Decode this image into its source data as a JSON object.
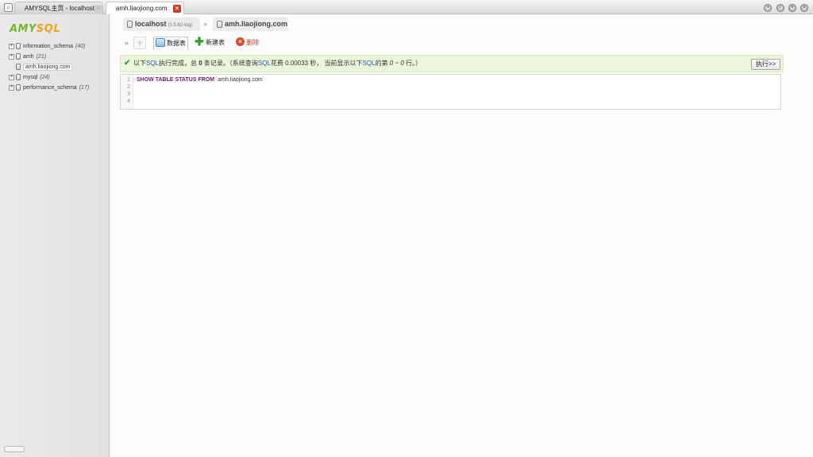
{
  "tabs": [
    {
      "label": "AMYSQL主页 - localhost",
      "active": false
    },
    {
      "label": "amh.liaojiong.com",
      "active": true
    }
  ],
  "logo": {
    "part1": "AMY",
    "part2": "SQL"
  },
  "sidebar": {
    "databases": [
      {
        "name": "information_schema",
        "count": "(40)",
        "expandable": true,
        "selected": false
      },
      {
        "name": "amh",
        "count": "(21)",
        "expandable": true,
        "selected": false
      },
      {
        "name": "amh.liaojiong.com",
        "count": "",
        "expandable": false,
        "selected": true
      },
      {
        "name": "mysql",
        "count": "(24)",
        "expandable": true,
        "selected": false
      },
      {
        "name": "performance_schema",
        "count": "(17)",
        "expandable": true,
        "selected": false
      }
    ]
  },
  "breadcrumb": {
    "host": "localhost",
    "version": "(5.5.62-log)",
    "separator": "»",
    "database": "amh.liaojiong.com"
  },
  "toolbar": {
    "arrow": "»",
    "table_label": "数据表",
    "new_table_label": "新建表",
    "delete_label": "删除"
  },
  "message": {
    "p1": "以下",
    "sql1": "SQL",
    "p2": "执行完成，总 ",
    "total": "0",
    "p3": " 条记录。（系统查询",
    "sql2": "SQL",
    "p4": "花费 0.00033 秒， 当前显示以下",
    "sql3": "SQL",
    "p5": "的第 ",
    "range": "0 ~ 0",
    "p6": " 行。）"
  },
  "execute_button": "执行>>",
  "editor": {
    "line_numbers": [
      "1",
      "2",
      "3",
      "4"
    ],
    "keyword": "SHOW TABLE STATUS FROM",
    "argument": " `amh.liaojiong.com`"
  },
  "colors": {
    "accent_green": "#7ab62d",
    "accent_orange": "#f0a31a",
    "success_bg": "#eaf5dc",
    "delete_red": "#c0392b"
  }
}
